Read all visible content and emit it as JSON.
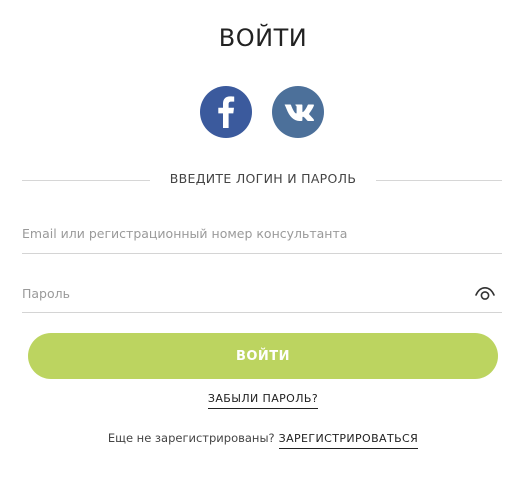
{
  "page": {
    "title": "ВОЙТИ"
  },
  "social": {
    "facebook": {
      "icon": "facebook-icon",
      "color": "#3b5a9d"
    },
    "vk": {
      "icon": "vk-icon",
      "color": "#4c709a"
    }
  },
  "divider": {
    "text": "ВВЕДИТЕ ЛОГИН И ПАРОЛЬ"
  },
  "form": {
    "email": {
      "placeholder": "Email или регистрационный номер консультанта",
      "value": ""
    },
    "password": {
      "placeholder": "Пароль",
      "value": "",
      "toggle_icon": "eye-icon"
    },
    "submit_label": "ВОЙТИ",
    "submit_color": "#bcd460"
  },
  "links": {
    "forgot_password": "ЗАБЫЛИ ПАРОЛЬ?",
    "not_registered": "Еще не зарегистрированы?",
    "register": "ЗАРЕГИСТРИРОВАТЬСЯ"
  }
}
